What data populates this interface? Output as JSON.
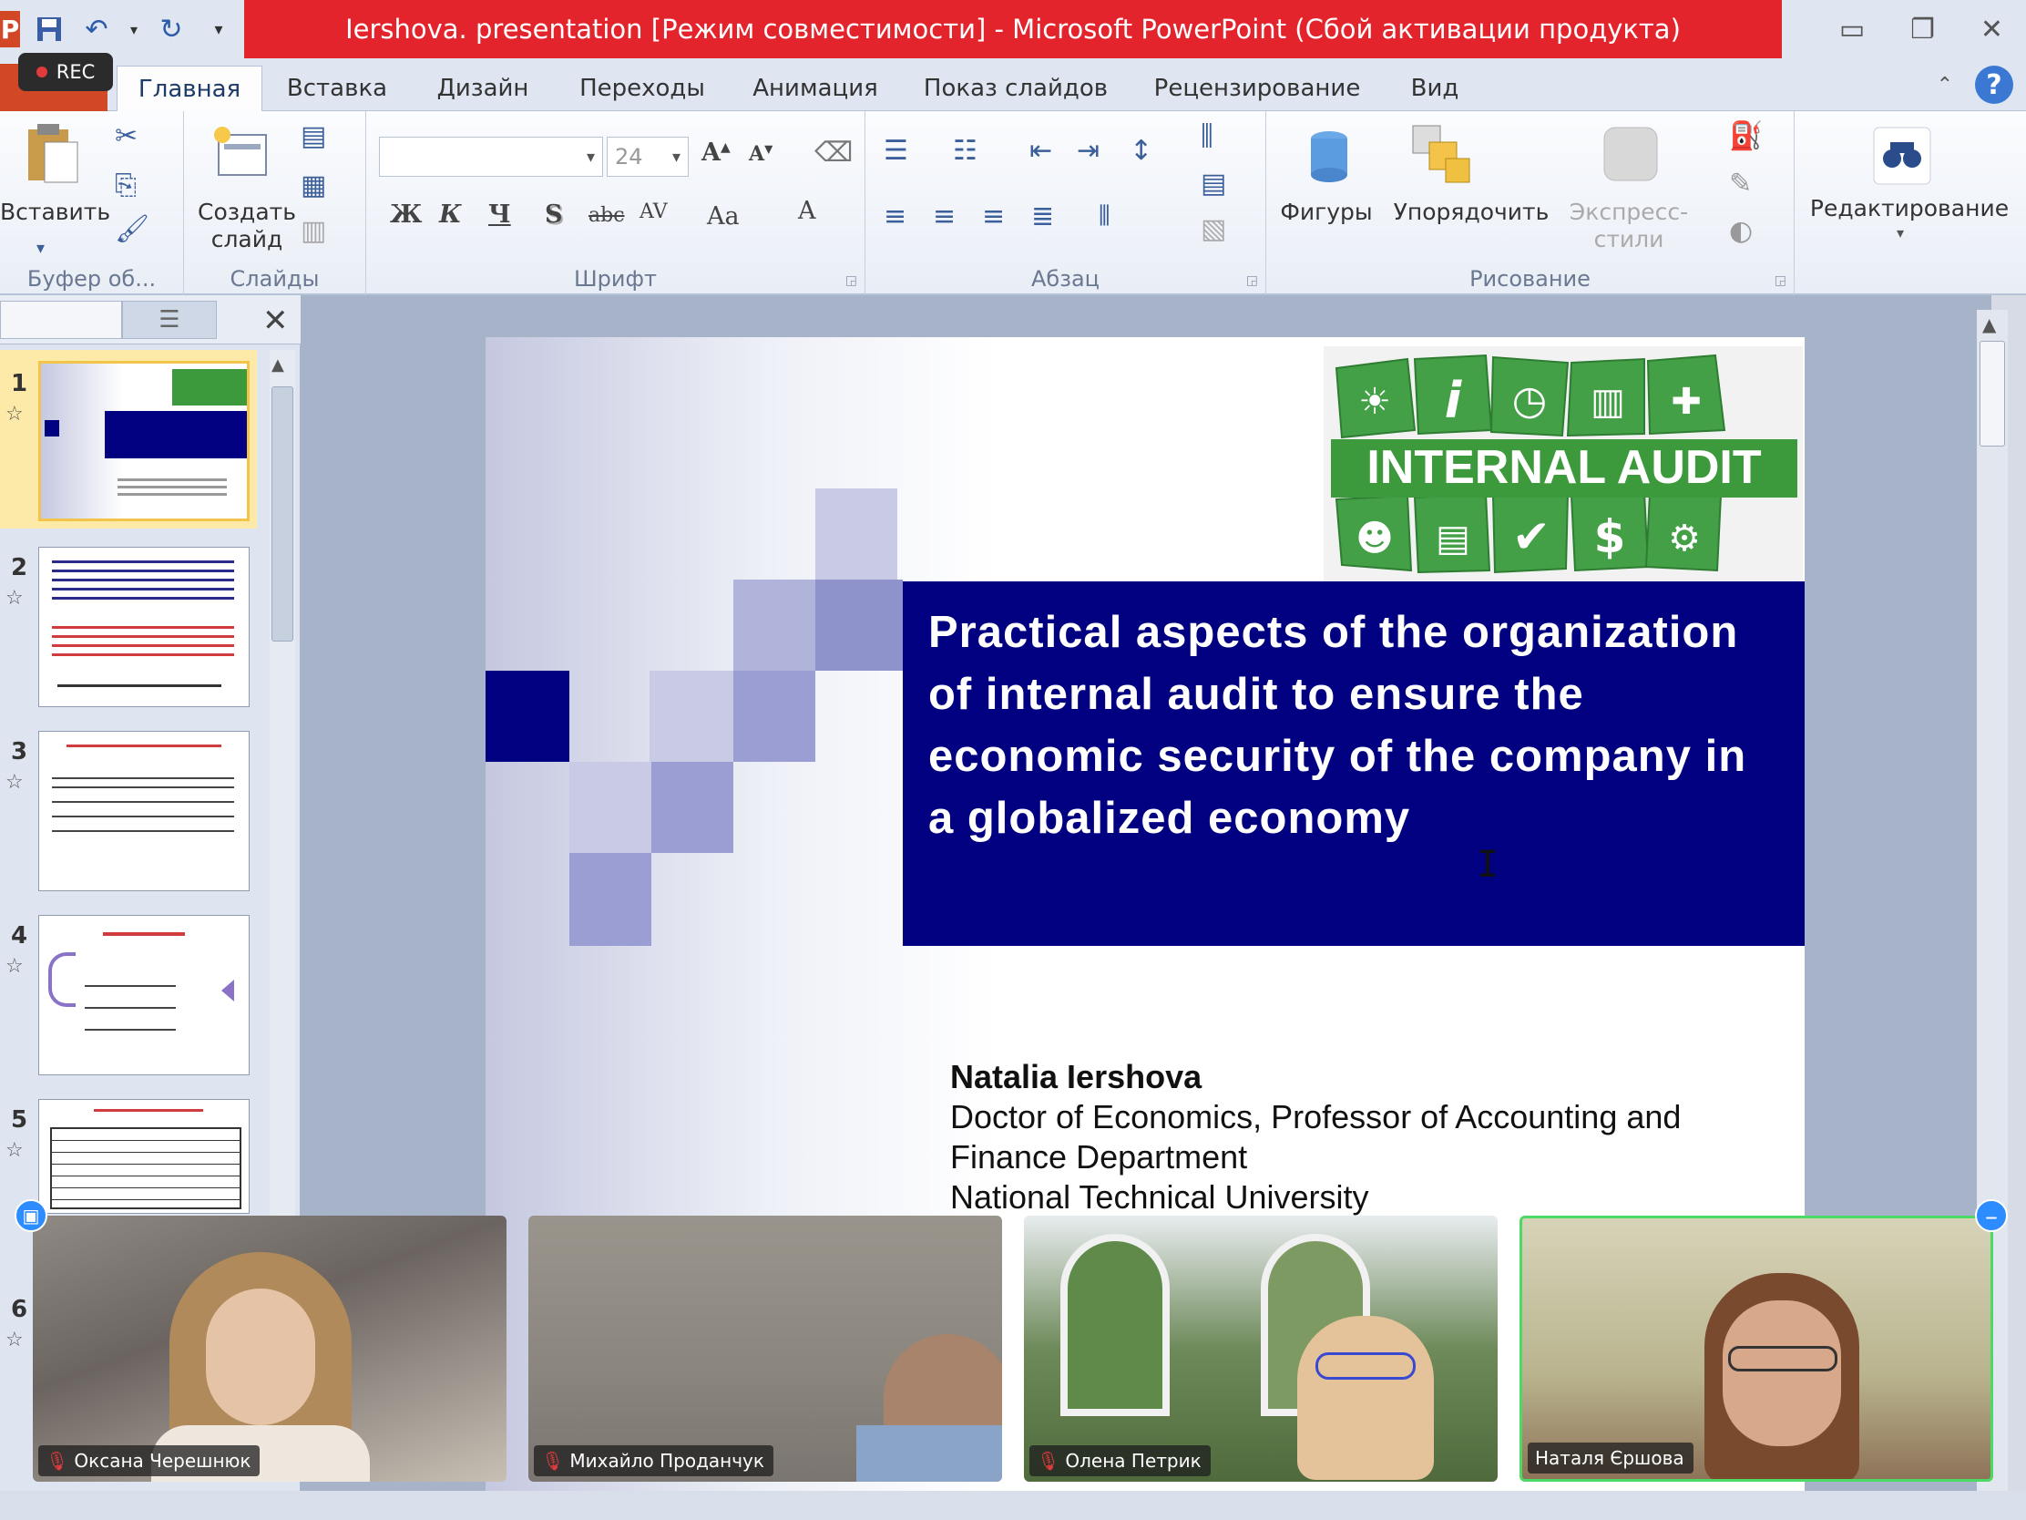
{
  "window": {
    "app_letter": "P",
    "title": "Iershova. presentation [Режим совместимости]  -  Microsoft PowerPoint (Сбой активации продукта)",
    "rec_label": "REC"
  },
  "tabs": [
    {
      "label": "Главная",
      "active": true
    },
    {
      "label": "Вставка"
    },
    {
      "label": "Дизайн"
    },
    {
      "label": "Переходы"
    },
    {
      "label": "Анимация"
    },
    {
      "label": "Показ слайдов"
    },
    {
      "label": "Рецензирование"
    },
    {
      "label": "Вид"
    }
  ],
  "ribbon": {
    "clipboard": {
      "paste": "Вставить",
      "group": "Буфер об..."
    },
    "slides": {
      "new_slide_1": "Создать",
      "new_slide_2": "слайд",
      "group": "Слайды"
    },
    "font": {
      "size": "24",
      "group": "Шрифт",
      "bold": "Ж",
      "italic": "К",
      "underline": "Ч",
      "shadow": "S",
      "strike": "abc",
      "spacing": "AV",
      "case": "Aa",
      "color": "A"
    },
    "paragraph": {
      "group": "Абзац"
    },
    "drawing": {
      "shapes": "Фигуры",
      "arrange": "Упорядочить",
      "styles": "Экспресс-стили",
      "group": "Рисование"
    },
    "editing": {
      "label": "Редактирование"
    }
  },
  "slides_panel": {
    "items": [
      {
        "num": "1"
      },
      {
        "num": "2"
      },
      {
        "num": "3"
      },
      {
        "num": "4"
      },
      {
        "num": "5"
      },
      {
        "num": "6"
      }
    ]
  },
  "slide": {
    "logo_text": "INTERNAL AUDIT",
    "title": "Practical aspects of the organization of internal audit to ensure the economic security of the company in a globalized economy",
    "author_name": "Natalia Iershova",
    "author_line1": "Doctor of Economics, Professor of Accounting and",
    "author_line2": "Finance Department",
    "author_line3": "National Technical University"
  },
  "participants": [
    {
      "name": "Оксана Черешнюк",
      "muted": true
    },
    {
      "name": "Михайло Проданчук",
      "muted": true
    },
    {
      "name": "Олена Петрик",
      "muted": true
    },
    {
      "name": "Наталя Єршова",
      "muted": false
    }
  ],
  "colors": {
    "title_bar": "#e4242c",
    "banner": "#000080",
    "logo_green": "#3c9a3c",
    "active_speaker": "#4cd964"
  }
}
